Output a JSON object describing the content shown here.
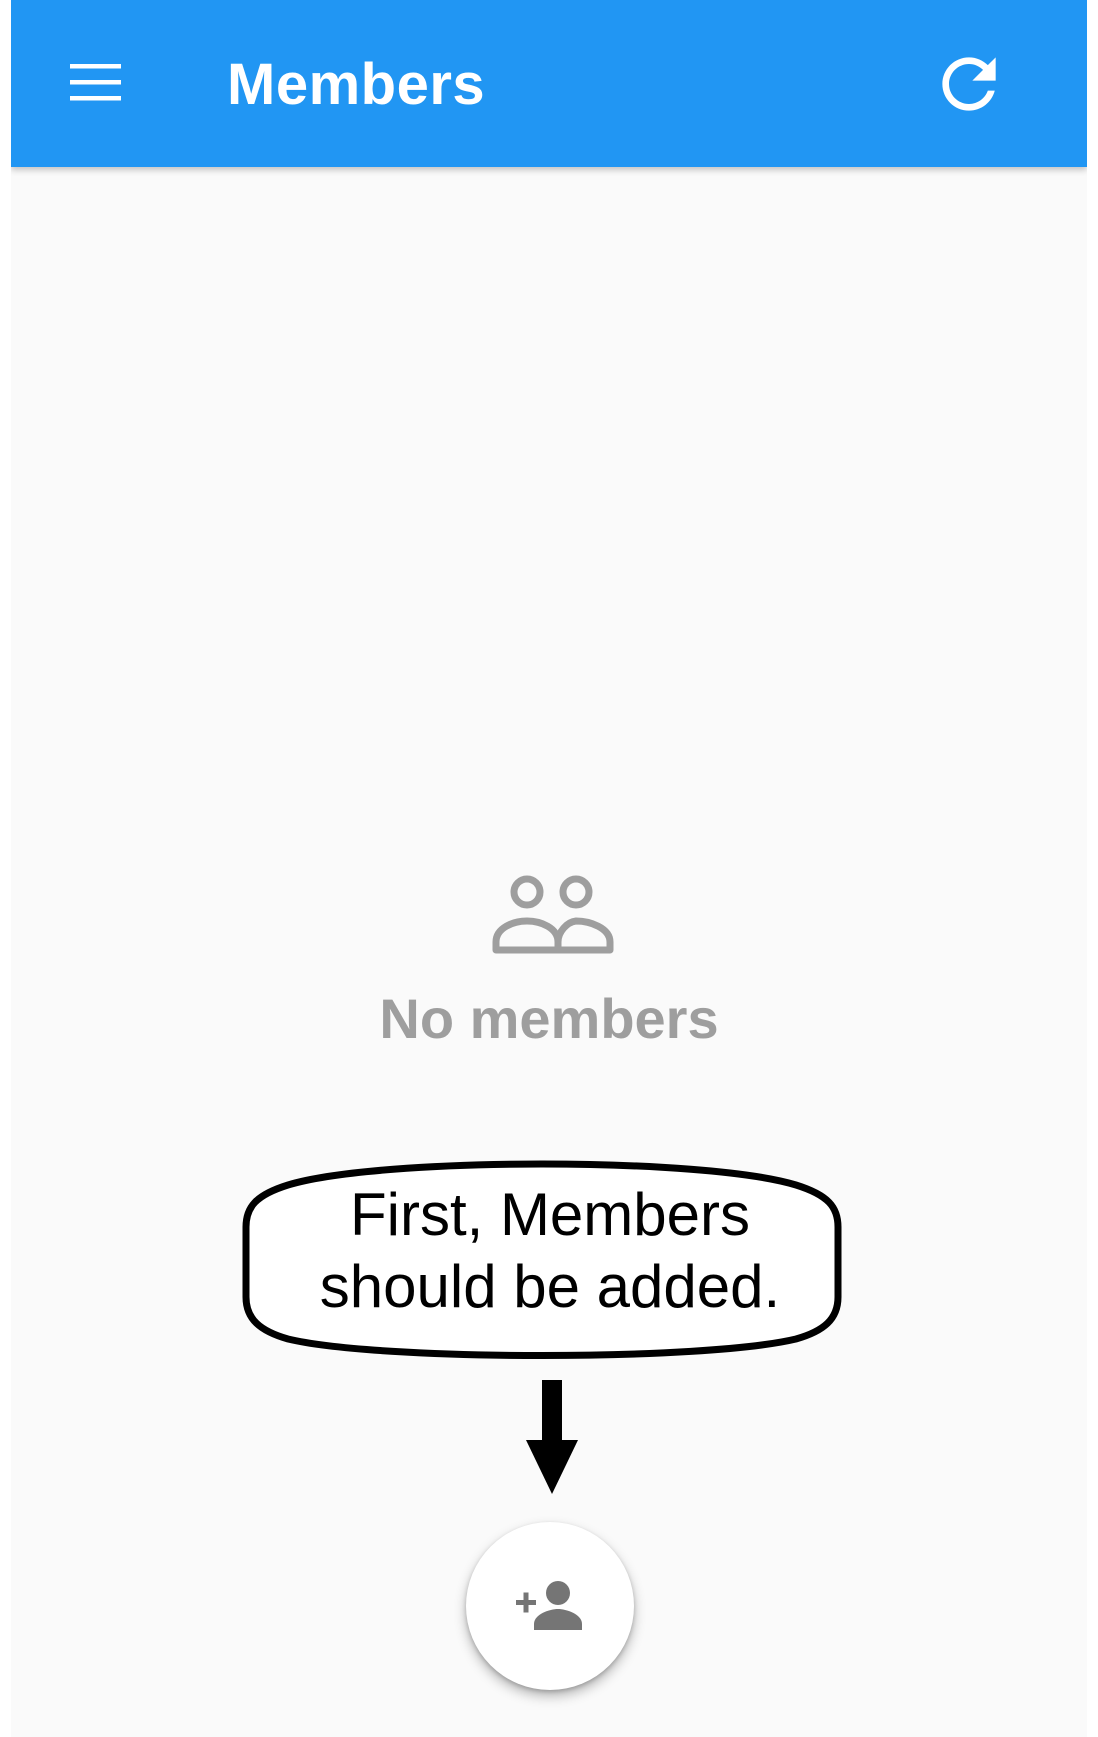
{
  "app_bar": {
    "title": "Members",
    "background_color": "#2196f3",
    "menu_icon": "hamburger-menu-icon",
    "refresh_icon": "refresh-icon"
  },
  "empty_state": {
    "icon": "people-outline-icon",
    "message": "No members",
    "text_color": "#9e9e9e"
  },
  "annotation": {
    "text_line1": "First, Members",
    "text_line2": "should be added.",
    "arrow": "down-arrow-icon"
  },
  "fab": {
    "icon": "person-add-icon"
  }
}
